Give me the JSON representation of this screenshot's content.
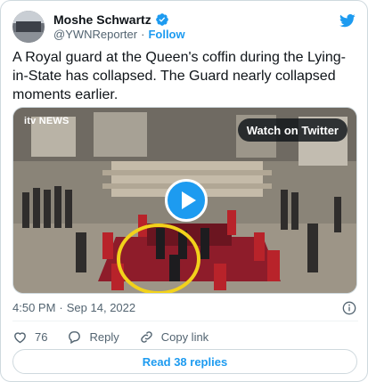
{
  "author": {
    "name": "Moshe Schwartz",
    "handle": "@YWNReporter",
    "follow_label": "Follow",
    "separator": "·"
  },
  "tweet": {
    "text": "A Royal guard at the Queen's coffin during the Lying-in-State has collapsed. The Guard nearly collapsed moments earlier."
  },
  "media": {
    "watch_label": "Watch on Twitter",
    "watermark": "itv NEWS"
  },
  "meta": {
    "time": "4:50 PM",
    "separator": "·",
    "date": "Sep 14, 2022"
  },
  "actions": {
    "like_count": "76",
    "reply_label": "Reply",
    "copy_label": "Copy link"
  },
  "footer": {
    "replies_label": "Read 38 replies"
  },
  "colors": {
    "accent": "#1d9bf0",
    "highlight_circle": "#f2d21b",
    "text_primary": "#0f1419",
    "text_secondary": "#536471"
  },
  "icons": {
    "verified": "verified-badge-icon",
    "brand": "twitter-bird-icon",
    "info": "info-icon",
    "like": "heart-icon",
    "reply": "reply-bubble-icon",
    "copy": "link-icon",
    "play": "play-icon"
  }
}
